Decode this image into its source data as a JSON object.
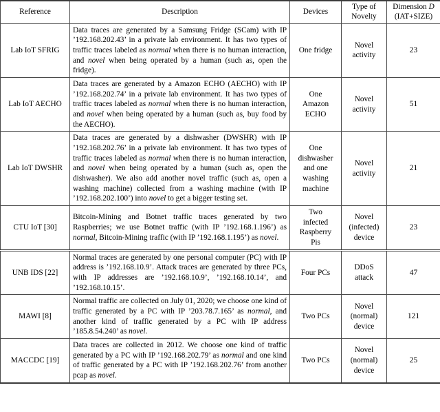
{
  "table": {
    "columns": [
      {
        "id": "reference",
        "label": "Reference"
      },
      {
        "id": "description",
        "label": "Description"
      },
      {
        "id": "devices",
        "label": "Devices"
      },
      {
        "id": "novelty",
        "label_line1": "Type of",
        "label_line2": "Novelty"
      },
      {
        "id": "dimension",
        "label_line1": "Dimension D",
        "label_line2": "(IAT+SIZE)"
      }
    ],
    "rows": [
      {
        "reference": "Lab IoT SFRIG",
        "description_parts": [
          {
            "t": "Data traces are generated by a Samsung Fridge (SCam) with IP ’192.168.202.43’ in a private lab environment. It has two types of traffic traces labeled as ",
            "i": false
          },
          {
            "t": "normal",
            "i": true
          },
          {
            "t": " when there is no human interaction, and ",
            "i": false
          },
          {
            "t": "novel",
            "i": true
          },
          {
            "t": " when being operated by a human (such as, open the fridge).",
            "i": false
          }
        ],
        "devices": "One fridge",
        "novelty_line1": "Novel",
        "novelty_line2": "activity",
        "novelty_line3": "",
        "dimension": "23"
      },
      {
        "reference": "Lab IoT AECHO",
        "description_parts": [
          {
            "t": "Data traces are generated by a Amazon ECHO (AECHO) with IP ’192.168.202.74’ in a private lab environment. It has two types of traffic traces labeled as ",
            "i": false
          },
          {
            "t": "normal",
            "i": true
          },
          {
            "t": " when there is no human interaction, and ",
            "i": false
          },
          {
            "t": "novel",
            "i": true
          },
          {
            "t": " when being operated by a human (such as, buy food by the AECHO).",
            "i": false
          }
        ],
        "devices": "One\nAmazon\nECHO",
        "novelty_line1": "Novel",
        "novelty_line2": "activity",
        "novelty_line3": "",
        "dimension": "51"
      },
      {
        "reference": "Lab IoT DWSHR",
        "description_parts": [
          {
            "t": "Data traces are generated by a dishwasher (DWSHR) with IP ’192.168.202.76’ in a private lab environment. It has two types of traffic traces labeled as ",
            "i": false
          },
          {
            "t": "normal",
            "i": true
          },
          {
            "t": " when there is no human interaction, and ",
            "i": false
          },
          {
            "t": "novel",
            "i": true
          },
          {
            "t": " when being operated by a human (such as, open the dishwasher). We also add another novel traffic (such as, open a washing machine) collected from a washing machine (with IP ’192.168.202.100’) into ",
            "i": false
          },
          {
            "t": "novel",
            "i": true
          },
          {
            "t": " to get a bigger testing set.",
            "i": false
          }
        ],
        "devices": "One\ndishwasher\nand one\nwashing\nmachine",
        "novelty_line1": "Novel",
        "novelty_line2": "activity",
        "novelty_line3": "",
        "dimension": "21"
      },
      {
        "reference": "CTU IoT [30]",
        "description_parts": [
          {
            "t": "Bitcoin-Mining and Botnet traffic traces generated by two Raspberries; we use Botnet traffic (with IP ’192.168.1.196’) as ",
            "i": false
          },
          {
            "t": "normal",
            "i": true
          },
          {
            "t": ", Bitcoin-Mining traffic (with IP ’192.168.1.195’) as ",
            "i": false
          },
          {
            "t": "novel",
            "i": true
          },
          {
            "t": ".",
            "i": false
          }
        ],
        "devices": "Two\ninfected\nRaspberry\nPis",
        "novelty_line1": "Novel",
        "novelty_line2": "(infected)",
        "novelty_line3": "device",
        "dimension": "23",
        "thick_after": true
      },
      {
        "reference": "UNB IDS [22]",
        "description_parts": [
          {
            "t": "Normal traces are generated by one personal computer (PC) with IP address is ’192.168.10.9’. Attack traces are generated by three PCs, with IP addresses are ’192.168.10.9’, ’192.168.10.14’, and ’192.168.10.15’.",
            "i": false
          }
        ],
        "devices": "Four PCs",
        "novelty_line1": "DDoS",
        "novelty_line2": "attack",
        "novelty_line3": "",
        "dimension": "47"
      },
      {
        "reference": "MAWI [8]",
        "description_parts": [
          {
            "t": "Normal traffic are collected on July 01, 2020; we choose one kind of traffic generated by a PC with IP ’203.78.7.165’ as ",
            "i": false
          },
          {
            "t": "normal",
            "i": true
          },
          {
            "t": ", and another kind of traffic generated by a PC with IP address ’185.8.54.240’ as ",
            "i": false
          },
          {
            "t": "novel",
            "i": true
          },
          {
            "t": ".",
            "i": false
          }
        ],
        "devices": "Two PCs",
        "novelty_line1": "Novel",
        "novelty_line2": "(normal)",
        "novelty_line3": "device",
        "dimension": "121"
      },
      {
        "reference": "MACCDC [19]",
        "description_parts": [
          {
            "t": "Data traces are collected in 2012. We choose one kind of traffic generated by a PC with IP ’192.168.202.79’ as ",
            "i": false
          },
          {
            "t": "normal",
            "i": true
          },
          {
            "t": " and one kind of traffic generated by a PC with IP ’192.168.202.76’ from another pcap as ",
            "i": false
          },
          {
            "t": "novel",
            "i": true
          },
          {
            "t": ".",
            "i": false
          }
        ],
        "devices": "Two PCs",
        "novelty_line1": "Novel",
        "novelty_line2": "(normal)",
        "novelty_line3": "device",
        "dimension": "25"
      }
    ]
  }
}
